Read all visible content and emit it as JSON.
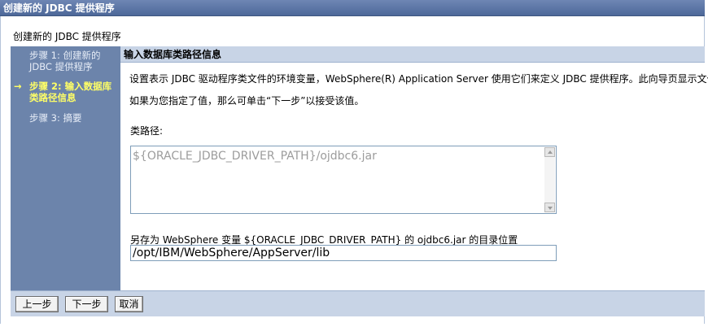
{
  "window": {
    "title": "创建新的 JDBC 提供程序"
  },
  "page": {
    "heading": "创建新的 JDBC 提供程序"
  },
  "steps": [
    {
      "label": "步骤 1: 创建新的 JDBC 提供程序",
      "current": false
    },
    {
      "label": "步骤 2: 输入数据库类路径信息",
      "current": true,
      "arrow": "→"
    },
    {
      "label": "步骤 3: 摘要",
      "current": false
    }
  ],
  "section": {
    "title": "输入数据库类路径信息",
    "description_line1": "设置表示 JDBC 驱动程序类文件的环境变量，WebSphere(R) Application Server 使用它们来定义 JDBC 提供程序。此向导页显示文件名，",
    "description_line2": "如果为您指定了值，那么可单击“下一步”以接受该值。",
    "classpath_label": "类路径:",
    "classpath_value": "${ORACLE_JDBC_DRIVER_PATH}/ojdbc6.jar",
    "save_as_label": "另存为 WebSphere 变量 ${ORACLE_JDBC_DRIVER_PATH} 的 ojdbc6.jar 的目录位置",
    "directory_value": "/opt/IBM/WebSphere/AppServer/lib"
  },
  "footer": {
    "prev_label": "上一步",
    "next_label": "下一步",
    "cancel_label": "取消"
  },
  "colors": {
    "titlebar": "#5a74a4",
    "steps_panel": "#6c84ab",
    "current_step": "#ffff66",
    "section_header": "#c8d4e6"
  }
}
